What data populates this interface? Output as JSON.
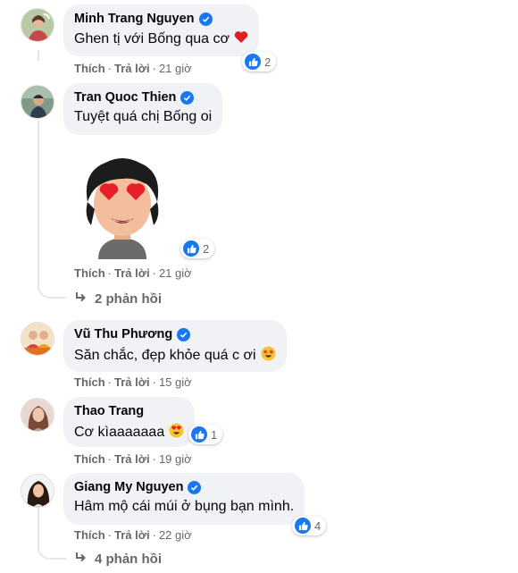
{
  "comments": [
    {
      "name": "Minh Trang Nguyen",
      "text": "Ghen tị với Bống qua cơ",
      "emoji": "red-heart",
      "like": "Thích",
      "reply": "Trả lời",
      "time": "21 giờ",
      "reactions": "2"
    },
    {
      "name": "Tran Quoc Thien",
      "text": "Tuyệt quá chị Bống oi",
      "sticker": "heart-eyes-memoji-sticker",
      "like": "Thích",
      "reply": "Trả lời",
      "time": "21 giờ",
      "reactions": "2",
      "replies": "2 phản hồi"
    },
    {
      "name": "Vũ Thu Phương",
      "text": "Săn chắc, đẹp khỏe quá c ơi",
      "emoji": "star-struck",
      "like": "Thích",
      "reply": "Trả lời",
      "time": "15 giờ"
    },
    {
      "name": "Thao Trang",
      "text": "Cơ kìaaaaaaa",
      "emoji": "heart-eyes",
      "like": "Thích",
      "reply": "Trả lời",
      "time": "19 giờ",
      "reactions": "1"
    },
    {
      "name": "Giang My Nguyen",
      "text": "Hâm mộ cái múi ở bụng bạn mình.",
      "like": "Thích",
      "reply": "Trả lời",
      "time": "22 giờ",
      "reactions": "4",
      "replies": "4 phản hồi"
    }
  ],
  "colors": {
    "accent": "#1877f2",
    "bubble": "#f0f2f5",
    "meta": "#65676b"
  }
}
